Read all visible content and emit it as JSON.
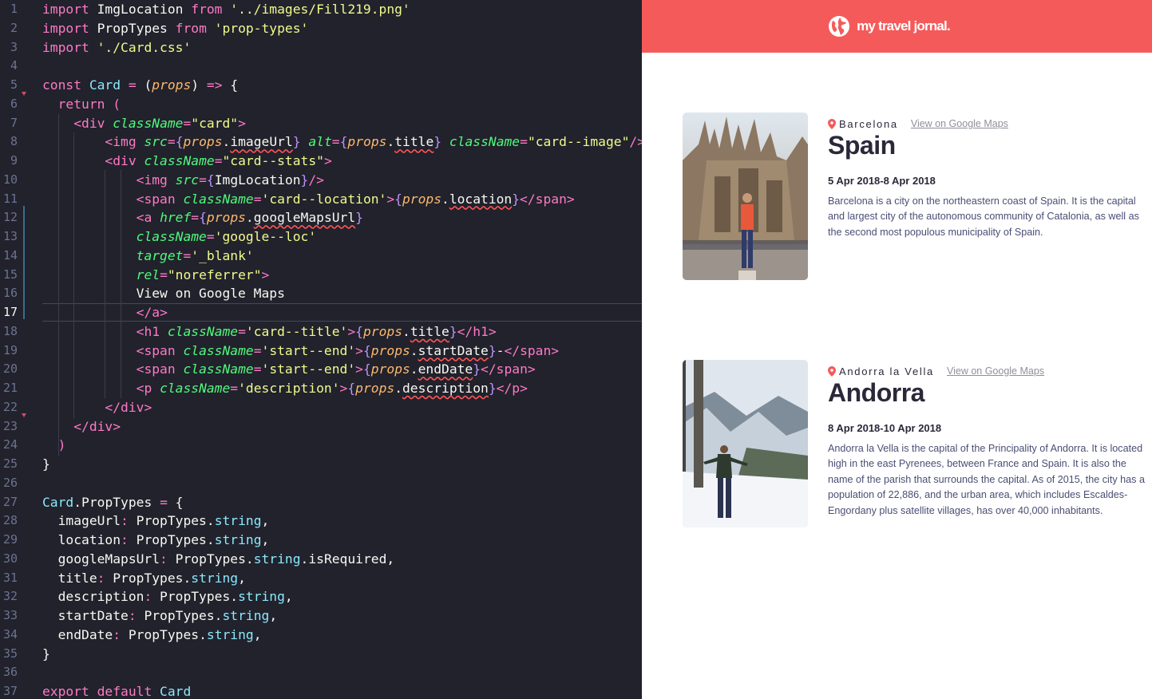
{
  "editor": {
    "active_line": 17,
    "lines": [
      {
        "n": "1"
      },
      {
        "n": "2"
      },
      {
        "n": "3"
      },
      {
        "n": "4"
      },
      {
        "n": "5"
      },
      {
        "n": "6"
      },
      {
        "n": "7"
      },
      {
        "n": "8"
      },
      {
        "n": "9"
      },
      {
        "n": "10"
      },
      {
        "n": "11"
      },
      {
        "n": "12"
      },
      {
        "n": "13"
      },
      {
        "n": "14"
      },
      {
        "n": "15"
      },
      {
        "n": "16"
      },
      {
        "n": "17"
      },
      {
        "n": "18"
      },
      {
        "n": "19"
      },
      {
        "n": "20"
      },
      {
        "n": "21"
      },
      {
        "n": "22"
      },
      {
        "n": "23"
      },
      {
        "n": "24"
      },
      {
        "n": "25"
      },
      {
        "n": "26"
      },
      {
        "n": "27"
      },
      {
        "n": "28"
      },
      {
        "n": "29"
      },
      {
        "n": "30"
      },
      {
        "n": "31"
      },
      {
        "n": "32"
      },
      {
        "n": "33"
      },
      {
        "n": "34"
      },
      {
        "n": "35"
      },
      {
        "n": "36"
      },
      {
        "n": "37"
      }
    ],
    "code": [
      [
        [
          "k",
          "import "
        ],
        [
          "w",
          "ImgLocation "
        ],
        [
          "k",
          "from "
        ],
        [
          "s",
          "'../images/Fill219.png'"
        ]
      ],
      [
        [
          "k",
          "import "
        ],
        [
          "w",
          "PropTypes "
        ],
        [
          "k",
          "from "
        ],
        [
          "s",
          "'prop-types'"
        ]
      ],
      [
        [
          "k",
          "import "
        ],
        [
          "s",
          "'./Card.css'"
        ]
      ],
      [],
      [
        [
          "k",
          "const "
        ],
        [
          "f",
          "Card "
        ],
        [
          "k",
          "= "
        ],
        [
          "w",
          "("
        ],
        [
          "p",
          "props"
        ],
        [
          "w",
          ") "
        ],
        [
          "k",
          "=> "
        ],
        [
          "w",
          "{"
        ]
      ],
      [
        [
          "w",
          "  "
        ],
        [
          "k",
          "return "
        ],
        [
          "pu",
          "("
        ]
      ],
      [
        [
          "w",
          "    "
        ],
        [
          "pu",
          "<"
        ],
        [
          "t",
          "div "
        ],
        [
          "a",
          "className"
        ],
        [
          "pu",
          "="
        ],
        [
          "s",
          "\"card\""
        ],
        [
          "pu",
          ">"
        ]
      ],
      [
        [
          "w",
          "        "
        ],
        [
          "pu",
          "<"
        ],
        [
          "t",
          "img "
        ],
        [
          "a",
          "src"
        ],
        [
          "pu",
          "="
        ],
        [
          "purple",
          "{"
        ],
        [
          "p",
          "props"
        ],
        [
          "w",
          "."
        ],
        [
          "wsq",
          "imageUrl"
        ],
        [
          "purple",
          "}"
        ],
        [
          "w",
          " "
        ],
        [
          "a",
          "alt"
        ],
        [
          "pu",
          "="
        ],
        [
          "purple",
          "{"
        ],
        [
          "p",
          "props"
        ],
        [
          "w",
          "."
        ],
        [
          "wsq",
          "title"
        ],
        [
          "purple",
          "}"
        ],
        [
          "w",
          " "
        ],
        [
          "a",
          "className"
        ],
        [
          "pu",
          "="
        ],
        [
          "s",
          "\"card--image\""
        ],
        [
          "pu",
          "/>"
        ]
      ],
      [
        [
          "w",
          "        "
        ],
        [
          "pu",
          "<"
        ],
        [
          "t",
          "div "
        ],
        [
          "a",
          "className"
        ],
        [
          "pu",
          "="
        ],
        [
          "s",
          "\"card--stats\""
        ],
        [
          "pu",
          ">"
        ]
      ],
      [
        [
          "w",
          "            "
        ],
        [
          "pu",
          "<"
        ],
        [
          "t",
          "img "
        ],
        [
          "a",
          "src"
        ],
        [
          "pu",
          "="
        ],
        [
          "purple",
          "{"
        ],
        [
          "w",
          "ImgLocation"
        ],
        [
          "purple",
          "}"
        ],
        [
          "pu",
          "/>"
        ]
      ],
      [
        [
          "w",
          "            "
        ],
        [
          "pu",
          "<"
        ],
        [
          "t",
          "span "
        ],
        [
          "a",
          "className"
        ],
        [
          "pu",
          "="
        ],
        [
          "s",
          "'card--location'"
        ],
        [
          "pu",
          ">"
        ],
        [
          "purple",
          "{"
        ],
        [
          "p",
          "props"
        ],
        [
          "w",
          "."
        ],
        [
          "wsq",
          "location"
        ],
        [
          "purple",
          "}"
        ],
        [
          "pu",
          "</"
        ],
        [
          "t",
          "span"
        ],
        [
          "pu",
          ">"
        ]
      ],
      [
        [
          "w",
          "            "
        ],
        [
          "pu",
          "<"
        ],
        [
          "t",
          "a "
        ],
        [
          "a",
          "href"
        ],
        [
          "pu",
          "="
        ],
        [
          "purple",
          "{"
        ],
        [
          "p",
          "props"
        ],
        [
          "w",
          "."
        ],
        [
          "wsq",
          "googleMapsUrl"
        ],
        [
          "purple",
          "}"
        ]
      ],
      [
        [
          "w",
          "            "
        ],
        [
          "a",
          "className"
        ],
        [
          "pu",
          "="
        ],
        [
          "s",
          "'google--loc'"
        ]
      ],
      [
        [
          "w",
          "            "
        ],
        [
          "a",
          "target"
        ],
        [
          "pu",
          "="
        ],
        [
          "s",
          "'_blank'"
        ]
      ],
      [
        [
          "w",
          "            "
        ],
        [
          "a",
          "rel"
        ],
        [
          "pu",
          "="
        ],
        [
          "s",
          "\"noreferrer\""
        ],
        [
          "pu",
          ">"
        ]
      ],
      [
        [
          "w",
          "            View on Google Maps"
        ]
      ],
      [
        [
          "w",
          "            "
        ],
        [
          "pu",
          "</"
        ],
        [
          "t",
          "a"
        ],
        [
          "pu",
          ">"
        ]
      ],
      [
        [
          "w",
          "            "
        ],
        [
          "pu",
          "<"
        ],
        [
          "t",
          "h1 "
        ],
        [
          "a",
          "className"
        ],
        [
          "pu",
          "="
        ],
        [
          "s",
          "'card--title'"
        ],
        [
          "pu",
          ">"
        ],
        [
          "purple",
          "{"
        ],
        [
          "p",
          "props"
        ],
        [
          "w",
          "."
        ],
        [
          "wsq",
          "title"
        ],
        [
          "purple",
          "}"
        ],
        [
          "pu",
          "</"
        ],
        [
          "t",
          "h1"
        ],
        [
          "pu",
          ">"
        ]
      ],
      [
        [
          "w",
          "            "
        ],
        [
          "pu",
          "<"
        ],
        [
          "t",
          "span "
        ],
        [
          "a",
          "className"
        ],
        [
          "pu",
          "="
        ],
        [
          "s",
          "'start--end'"
        ],
        [
          "pu",
          ">"
        ],
        [
          "purple",
          "{"
        ],
        [
          "p",
          "props"
        ],
        [
          "w",
          "."
        ],
        [
          "wsq",
          "startDate"
        ],
        [
          "purple",
          "}"
        ],
        [
          "w",
          "-"
        ],
        [
          "pu",
          "</"
        ],
        [
          "t",
          "span"
        ],
        [
          "pu",
          ">"
        ]
      ],
      [
        [
          "w",
          "            "
        ],
        [
          "pu",
          "<"
        ],
        [
          "t",
          "span "
        ],
        [
          "a",
          "className"
        ],
        [
          "pu",
          "="
        ],
        [
          "s",
          "'start--end'"
        ],
        [
          "pu",
          ">"
        ],
        [
          "purple",
          "{"
        ],
        [
          "p",
          "props"
        ],
        [
          "w",
          "."
        ],
        [
          "wsq",
          "endDate"
        ],
        [
          "purple",
          "}"
        ],
        [
          "pu",
          "</"
        ],
        [
          "t",
          "span"
        ],
        [
          "pu",
          ">"
        ]
      ],
      [
        [
          "w",
          "            "
        ],
        [
          "pu",
          "<"
        ],
        [
          "t",
          "p "
        ],
        [
          "a",
          "className"
        ],
        [
          "pu",
          "="
        ],
        [
          "s",
          "'description'"
        ],
        [
          "pu",
          ">"
        ],
        [
          "purple",
          "{"
        ],
        [
          "p",
          "props"
        ],
        [
          "w",
          "."
        ],
        [
          "wsq",
          "description"
        ],
        [
          "purple",
          "}"
        ],
        [
          "pu",
          "</"
        ],
        [
          "t",
          "p"
        ],
        [
          "pu",
          ">"
        ]
      ],
      [
        [
          "w",
          "        "
        ],
        [
          "pu",
          "</"
        ],
        [
          "t",
          "div"
        ],
        [
          "pu",
          ">"
        ]
      ],
      [
        [
          "w",
          "    "
        ],
        [
          "pu",
          "</"
        ],
        [
          "t",
          "div"
        ],
        [
          "pu",
          ">"
        ]
      ],
      [
        [
          "w",
          "  "
        ],
        [
          "pu",
          ")"
        ]
      ],
      [
        [
          "w",
          "}"
        ]
      ],
      [],
      [
        [
          "cyan",
          "Card"
        ],
        [
          "w",
          "."
        ],
        [
          "w",
          "PropTypes "
        ],
        [
          "k",
          "= "
        ],
        [
          "w",
          "{"
        ]
      ],
      [
        [
          "w",
          "  imageUrl"
        ],
        [
          "k",
          ": "
        ],
        [
          "w",
          "PropTypes"
        ],
        [
          "w",
          "."
        ],
        [
          "cyan",
          "string"
        ],
        [
          "w",
          ","
        ]
      ],
      [
        [
          "w",
          "  location"
        ],
        [
          "k",
          ": "
        ],
        [
          "w",
          "PropTypes"
        ],
        [
          "w",
          "."
        ],
        [
          "cyan",
          "string"
        ],
        [
          "w",
          ","
        ]
      ],
      [
        [
          "w",
          "  googleMapsUrl"
        ],
        [
          "k",
          ": "
        ],
        [
          "w",
          "PropTypes"
        ],
        [
          "w",
          "."
        ],
        [
          "cyan",
          "string"
        ],
        [
          "w",
          "."
        ],
        [
          "w",
          "isRequired"
        ],
        [
          "w",
          ","
        ]
      ],
      [
        [
          "w",
          "  title"
        ],
        [
          "k",
          ": "
        ],
        [
          "w",
          "PropTypes"
        ],
        [
          "w",
          "."
        ],
        [
          "cyan",
          "string"
        ],
        [
          "w",
          ","
        ]
      ],
      [
        [
          "w",
          "  description"
        ],
        [
          "k",
          ": "
        ],
        [
          "w",
          "PropTypes"
        ],
        [
          "w",
          "."
        ],
        [
          "cyan",
          "string"
        ],
        [
          "w",
          ","
        ]
      ],
      [
        [
          "w",
          "  startDate"
        ],
        [
          "k",
          ": "
        ],
        [
          "w",
          "PropTypes"
        ],
        [
          "w",
          "."
        ],
        [
          "cyan",
          "string"
        ],
        [
          "w",
          ","
        ]
      ],
      [
        [
          "w",
          "  endDate"
        ],
        [
          "k",
          ": "
        ],
        [
          "w",
          "PropTypes"
        ],
        [
          "w",
          "."
        ],
        [
          "cyan",
          "string"
        ],
        [
          "w",
          ","
        ]
      ],
      [
        [
          "w",
          "}"
        ]
      ],
      [],
      [
        [
          "k",
          "export "
        ],
        [
          "k",
          "default "
        ],
        [
          "f",
          "Card"
        ]
      ]
    ]
  },
  "preview": {
    "navbar": {
      "brand": "my travel jornal.",
      "icon": "globe-icon",
      "color": "#f55a5a"
    },
    "cards": [
      {
        "location": "Barcelona",
        "link": "View on Google Maps",
        "title": "Spain",
        "dates": "5 Apr 2018-8 Apr 2018",
        "description": "Barcelona is a city on the northeastern coast of Spain. It is the capital and largest city of the autonomous community of Catalonia, as well as the second most populous municipality of Spain."
      },
      {
        "location": "Andorra la Vella",
        "link": "View on Google Maps",
        "title": "Andorra",
        "dates": "8 Apr 2018-10 Apr 2018",
        "description": "Andorra la Vella is the capital of the Principality of Andorra. It is located high in the east Pyrenees, between France and Spain. It is also the name of the parish that surrounds the capital. As of 2015, the city has a population of 22,886, and the urban area, which includes Escaldes-Engordany plus satellite villages, has over 40,000 inhabitants."
      }
    ]
  }
}
